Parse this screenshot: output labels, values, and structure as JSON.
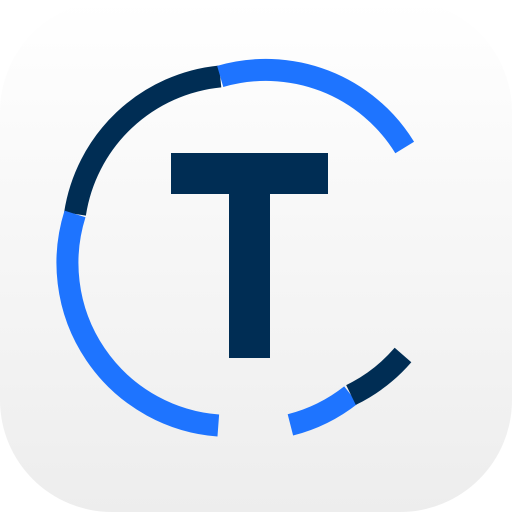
{
  "icon": {
    "name": "app-icon",
    "monogram": "T",
    "colors": {
      "background_top": "#ffffff",
      "background_bottom": "#ededed",
      "navy": "#002d54",
      "blue": "#1e74ff"
    }
  }
}
